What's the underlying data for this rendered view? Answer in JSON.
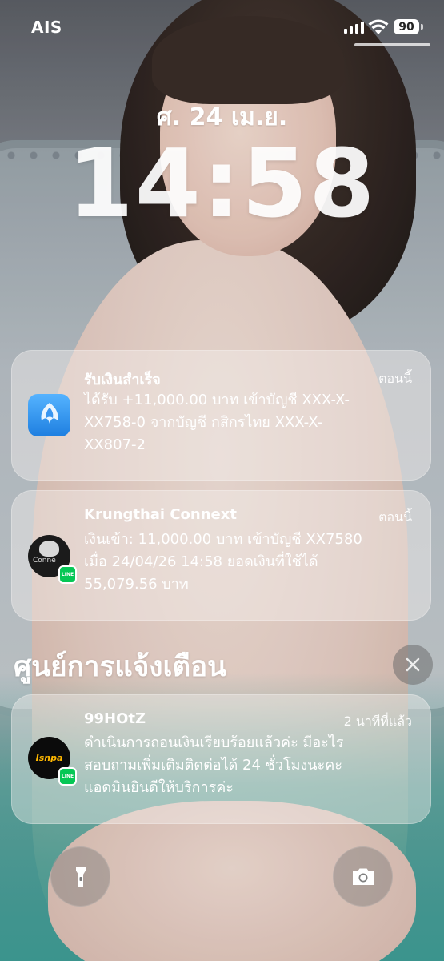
{
  "status_bar": {
    "carrier": "AIS",
    "battery": "90",
    "signal_bars": 4,
    "wifi_icon": "wifi-icon"
  },
  "lockscreen": {
    "date": "ศ. 24 เม.ย.",
    "time": "14:58"
  },
  "notifications": [
    {
      "app_icon": "kplus-icon",
      "title": "รับเงินสำเร็จ",
      "time": "ตอนนี้",
      "lines": [
        "ได้รับ +11,000.00 บาท เข้าบัญชี XXX-X-",
        "XX758-0 จากบัญชี กสิกรไทย XXX-X-",
        "XX807-2"
      ]
    },
    {
      "app_icon": "krungthai-connext-icon",
      "title": "Krungthai Connext",
      "time": "ตอนนี้",
      "lines": [
        "เงินเข้า: 11,000.00 บาท เข้าบัญชี XX7580",
        "เมื่อ 24/04/26 14:58 ยอดเงินที่ใช้ได้",
        "55,079.56 บาท"
      ],
      "icon_text": "Conne"
    }
  ],
  "notification_center": {
    "title": "ศูนย์การแจ้งเตือน",
    "items": [
      {
        "app_icon": "99hotz-icon",
        "title": "99HOtZ",
        "time": "2 นาทีที่แล้ว",
        "lines": [
          "ดำเนินการถอนเงินเรียบร้อยแล้วค่ะ มีอะไร",
          "สอบถามเพิ่มเติมติดต่อได้ 24 ชั่วโมงนะคะ",
          "แอดมินยินดีให้บริการค่ะ"
        ],
        "icon_text": "Isnpa"
      }
    ]
  },
  "badges": {
    "line": "LINE"
  },
  "colors": {
    "line_green": "#06c755",
    "card_bg": "rgba(245,240,238,.42)"
  }
}
